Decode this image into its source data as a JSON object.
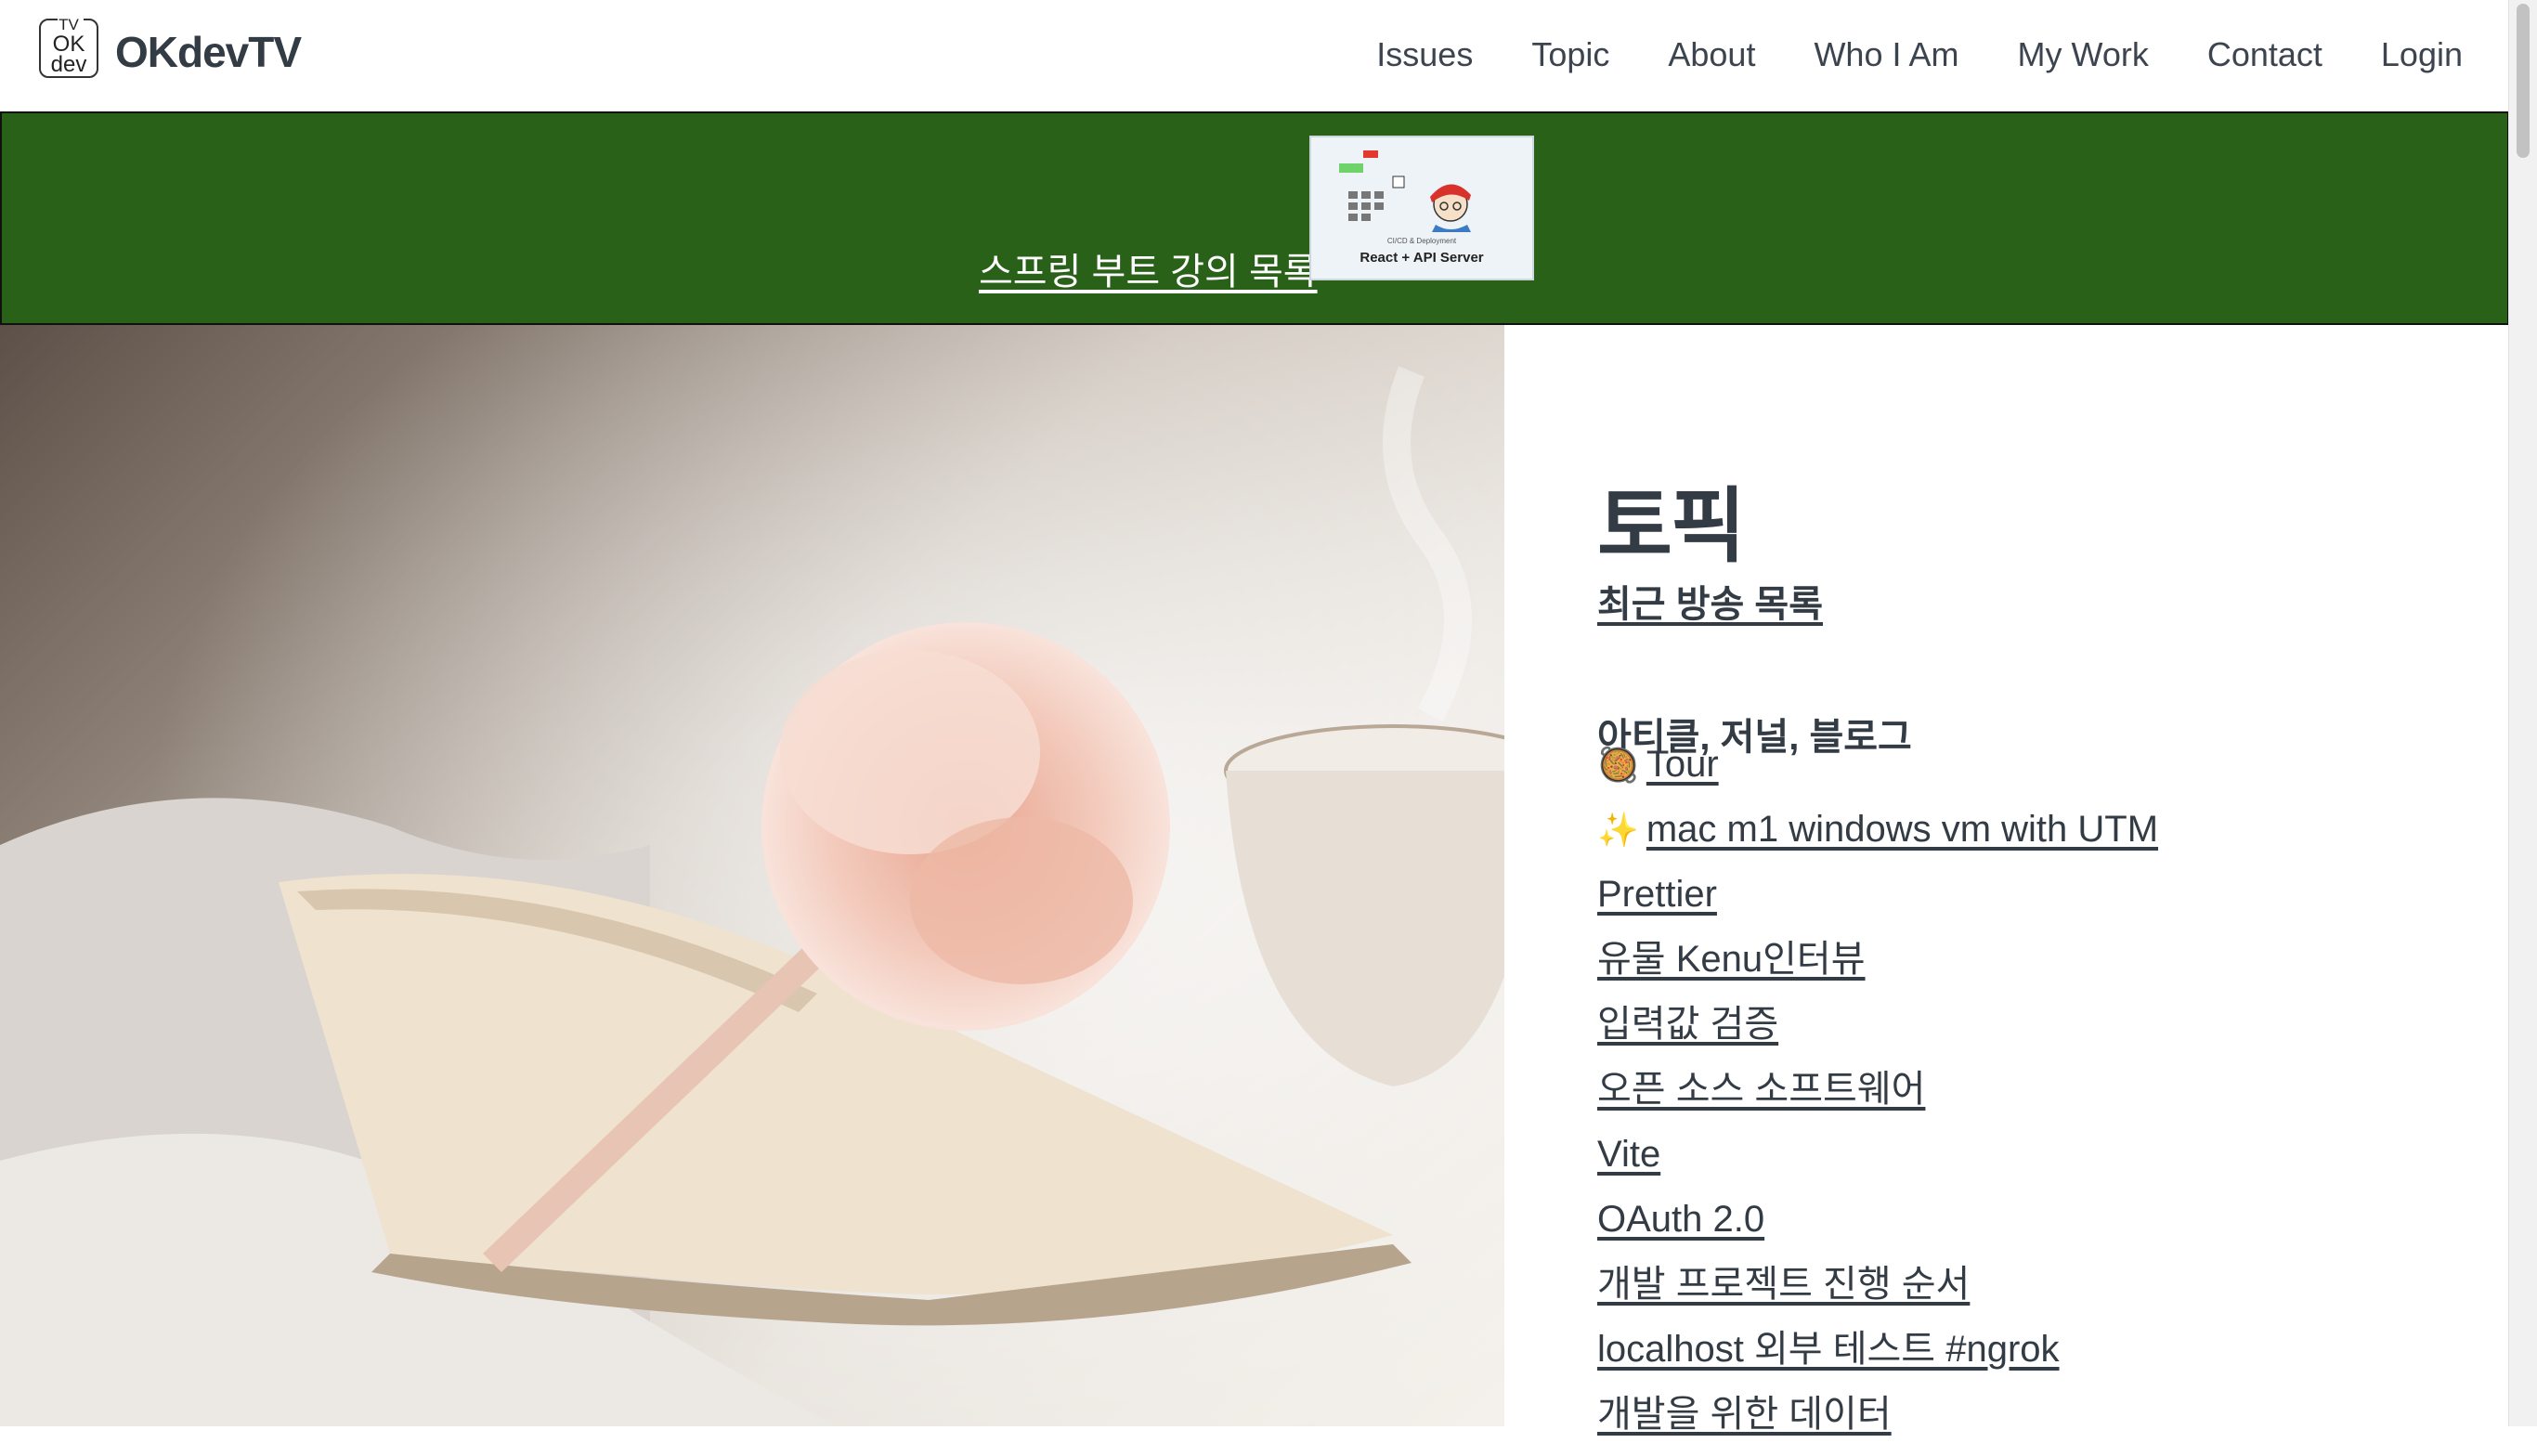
{
  "site": {
    "logo_top": "TV",
    "logo_mid": "OK",
    "logo_bottom": "dev",
    "name": "OKdevTV"
  },
  "nav": {
    "items": [
      {
        "label": "Issues"
      },
      {
        "label": "Topic"
      },
      {
        "label": "About"
      },
      {
        "label": "Who I Am"
      },
      {
        "label": "My Work"
      },
      {
        "label": "Contact"
      },
      {
        "label": "Login"
      }
    ]
  },
  "banner": {
    "link_text": "스프링 부트 강의 목록",
    "thumb_title": "React + API Server",
    "thumb_subtitle": "CI/CD & Deployment",
    "background_color": "#2a6119"
  },
  "content": {
    "title": "토픽",
    "recent_link": "최근 방송 목록",
    "section_heading": "아티클, 저널, 블로그",
    "links": [
      {
        "icon": "🥘",
        "label": "Tour"
      },
      {
        "icon": "✨",
        "label": "mac m1 windows vm with UTM"
      },
      {
        "icon": "",
        "label": "Prettier"
      },
      {
        "icon": "",
        "label": "유물 Kenu인터뷰"
      },
      {
        "icon": "",
        "label": "입력값 검증"
      },
      {
        "icon": "",
        "label": "오픈 소스 소프트웨어"
      },
      {
        "icon": "",
        "label": "Vite"
      },
      {
        "icon": "",
        "label": "OAuth 2.0"
      },
      {
        "icon": "",
        "label": "개발 프로젝트 진행 순서"
      },
      {
        "icon": "",
        "label": "localhost 외부 테스트 #ngrok"
      },
      {
        "icon": "",
        "label": "개발을 위한 데이터"
      }
    ]
  }
}
